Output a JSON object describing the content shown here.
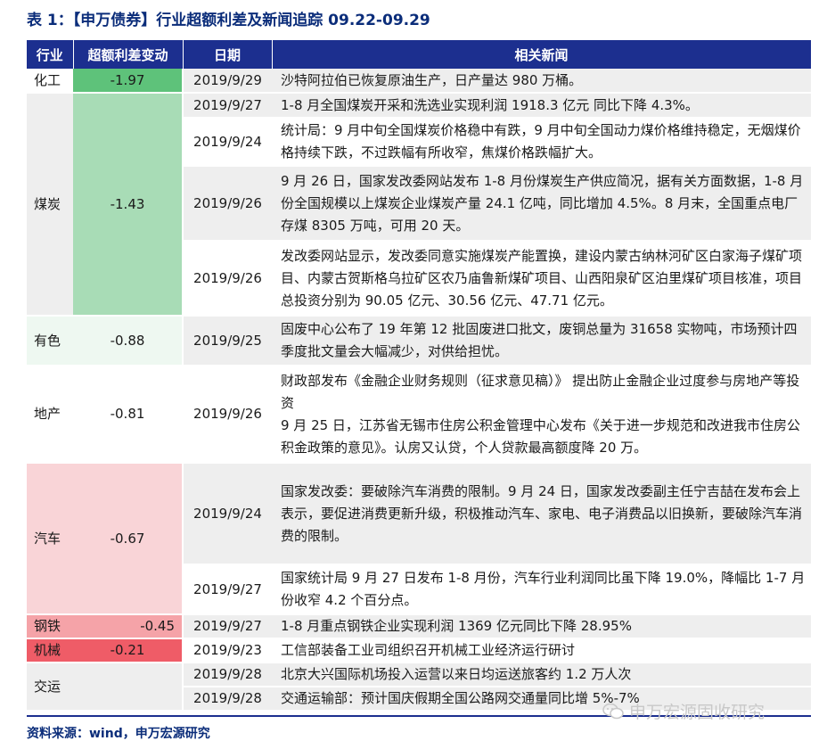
{
  "title": "表 1：【申万债券】行业超额利差及新闻追踪 09.22-09.29",
  "headers": [
    "行业",
    "超额利差变动",
    "日期",
    "相关新闻"
  ],
  "rows": [
    {
      "industry": "化工",
      "change": "-1.97",
      "date": "2019/9/29",
      "news": "沙特阿拉伯已恢复原油生产，日产量达 980 万桶。"
    },
    {
      "industry": "煤炭",
      "change": "-1.43",
      "date": "2019/9/27",
      "news": "1-8 月全国煤炭开采和洗选业实现利润 1918.3 亿元  同比下降 4.3%。"
    },
    {
      "industry": "",
      "change": "",
      "date": "2019/9/24",
      "news": "统计局：9 月中旬全国煤炭价格稳中有跌，9 月中旬全国动力煤价格维持稳定，无烟煤价格持续下跌，不过跌幅有所收窄，焦煤价格跌幅扩大。"
    },
    {
      "industry": "",
      "change": "",
      "date": "2019/9/26",
      "news": "9 月 26 日，国家发改委网站发布 1-8 月份煤炭生产供应简况，据有关方面数据，1-8 月份全国规模以上煤炭企业煤炭产量 24.1 亿吨，同比增加 4.5%。8 月末，全国重点电厂存煤 8305 万吨，可用 20 天。"
    },
    {
      "industry": "",
      "change": "",
      "date": "2019/9/26",
      "news": "发改委网站显示，发改委同意实施煤炭产能置换，建设内蒙古纳林河矿区白家海子煤矿项目、内蒙古贺斯格乌拉矿区农乃庙鲁新煤矿项目、山西阳泉矿区泊里煤矿项目核准，项目总投资分别为 90.05 亿元、30.56 亿元、47.71 亿元。"
    },
    {
      "industry": "有色",
      "change": "-0.88",
      "date": "2019/9/25",
      "news": "固废中心公布了 19 年第 12 批固废进口批文，废铜总量为 31658 实物吨，市场预计四季度批文量会大幅减少，对供给担忧。"
    },
    {
      "industry": "地产",
      "change": "-0.81",
      "date": "2019/9/26",
      "news": "财政部发布《金融企业财务规则（征求意见稿）》 提出防止金融企业过度参与房地产等投资",
      "news2": "9 月 25 日，江苏省无锡市住房公积金管理中心发布《关于进一步规范和改进我市住房公积金政策的意见》。认房又认贷，个人贷款最高额度降 20 万。"
    },
    {
      "industry": "汽车",
      "change": "-0.67",
      "date": "2019/9/24",
      "news": "国家发改委：要破除汽车消费的限制。9 月 24 日，国家发改委副主任宁吉喆在发布会上表示，要促进消费更新升级，积极推动汽车、家电、电子消费品以旧换新，要破除汽车消费的限制。"
    },
    {
      "industry": "",
      "change": "",
      "date": "2019/9/27",
      "news": "国家统计局 9 月 27 日发布 1-8 月份，汽车行业利润同比虽下降 19.0%，降幅比 1-7 月份收窄 4.2 个百分点。"
    },
    {
      "industry": "钢铁",
      "change": "-0.45",
      "date": "2019/9/27",
      "news": "1-8 月重点钢铁企业实现利润 1369 亿元同比下降 28.95%"
    },
    {
      "industry": "机械",
      "change": "-0.21",
      "date": "2019/9/23",
      "news": "工信部装备工业司组织召开机械工业经济运行研讨"
    },
    {
      "industry": "交运",
      "change": "",
      "date": "2019/9/28",
      "news": "北京大兴国际机场投入运营以来日均运送旅客约 1.2 万人次"
    },
    {
      "industry": "",
      "change": "",
      "date": "2019/9/28",
      "news": "交通运输部：预计国庆假期全国公路网交通量同比增 5%-7%"
    }
  ],
  "colors": {
    "header_bg": "#1c2f8f",
    "chem": "#5ec27a",
    "coal": "#a8dcb6",
    "metal": "#eef8f1",
    "estate": "#ffffff",
    "auto": "#f9d4d7",
    "steel": "#f5a3a8",
    "machine": "#ef5c67"
  },
  "footer": "资料来源：wind，申万宏源研究",
  "watermark": "申万宏源固收研究"
}
